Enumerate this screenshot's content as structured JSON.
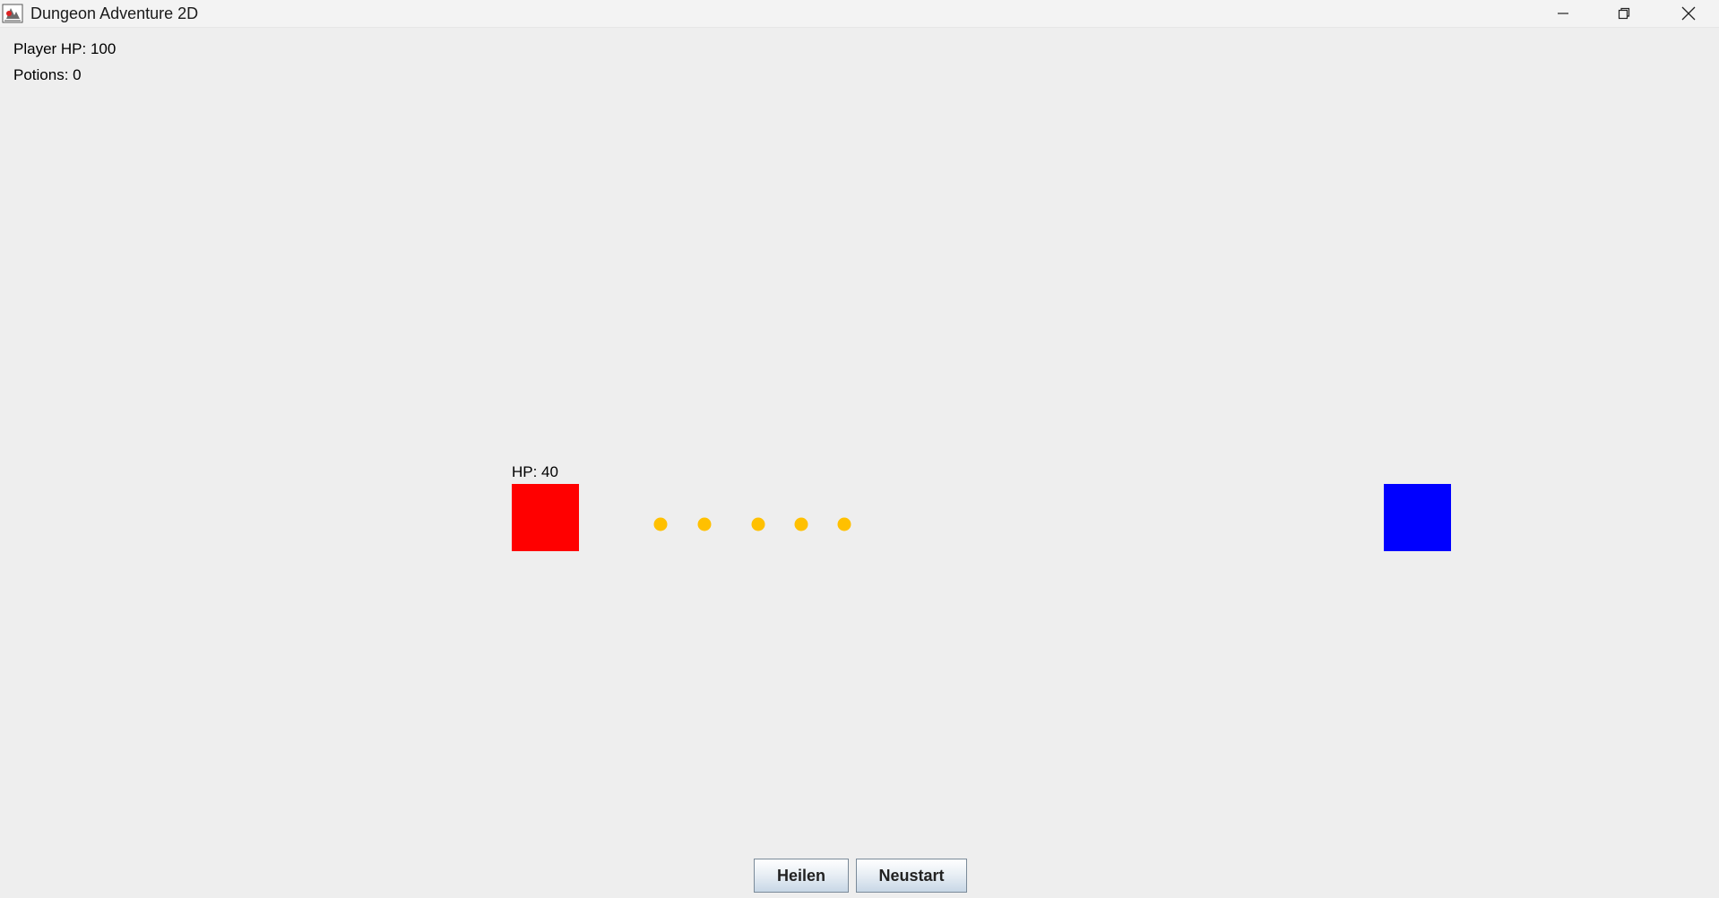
{
  "window": {
    "title": "Dungeon Adventure 2D",
    "icons": [
      "java-app-icon",
      "minimize-icon",
      "maximize-icon",
      "close-icon"
    ]
  },
  "hud": {
    "player_hp_text": "Player HP: 100",
    "potions_text": "Potions: 0"
  },
  "game": {
    "enemy": {
      "hp_text": "HP: 40",
      "color": "#ff0000"
    },
    "player": {
      "color": "#0000ff"
    },
    "projectiles": {
      "count": 5,
      "color": "#ffc000"
    }
  },
  "buttons": {
    "heal_label": "Heilen",
    "restart_label": "Neustart"
  },
  "colors": {
    "background": "#eeeeee",
    "titlebar": "#f3f3f3"
  }
}
